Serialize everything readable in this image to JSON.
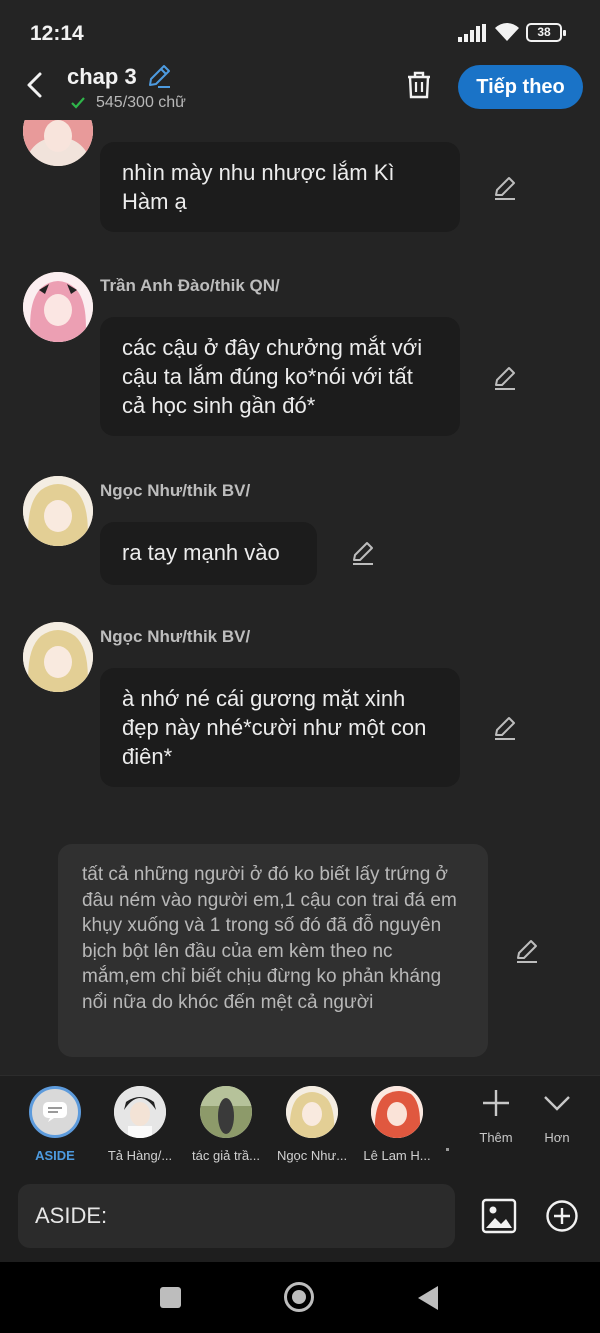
{
  "status_bar": {
    "time": "12:14",
    "battery": "38"
  },
  "header": {
    "title": "chap 3",
    "word_count": "545/300 chữ",
    "next_label": "Tiếp theo"
  },
  "messages": [
    {
      "author": "",
      "text": "nhìn mày nhu nhược lắm Kì Hàm ạ"
    },
    {
      "author": "Trần Anh Đào/thik QN/",
      "text": "các cậu ở đây chưởng mắt với cậu ta lắm đúng ko*nói với tất cả học sinh gần đó*"
    },
    {
      "author": "Ngọc Như/thik BV/",
      "text": "ra tay mạnh vào"
    },
    {
      "author": "Ngọc Như/thik BV/",
      "text": "à nhớ né cái gương mặt xinh đẹp này nhé*cười như một con điên*"
    }
  ],
  "aside_text": "tất cả những người ở đó ko biết lấy trứng ở đâu ném vào người em,1 cậu con trai đá em khụy xuống và 1 trong số đó đã đỗ nguyên bịch bột lên đầu của em kèm theo nc mắm,em chỉ biết chịu đừng ko phản kháng nổi nữa do khóc đến mệt cả người",
  "characters": [
    {
      "name": "ASIDE"
    },
    {
      "name": "Tả Hàng/..."
    },
    {
      "name": "tác giả trầ..."
    },
    {
      "name": "Ngọc Như..."
    },
    {
      "name": "Lê Lam H..."
    }
  ],
  "char_bar_actions": {
    "more": "Thêm",
    "expand": "Hơn"
  },
  "input": {
    "placeholder": "ASIDE:"
  },
  "colors": {
    "accent": "#1a73c7",
    "aside_selected": "#4d9be0",
    "background": "#242424"
  }
}
